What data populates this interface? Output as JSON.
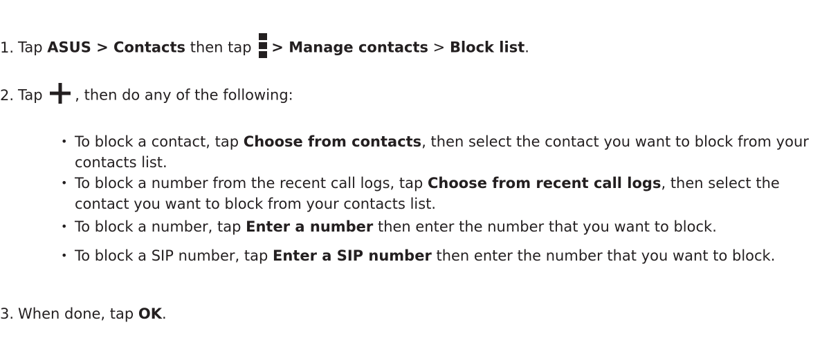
{
  "steps": [
    {
      "number": "1.",
      "t1": "Tap ",
      "b1": "ASUS > Contacts",
      "t2": " then tap ",
      "icon": "overflow-menu-icon",
      "b2": "> Manage contacts",
      "t3": " > ",
      "b3": "Block list",
      "t4": "."
    },
    {
      "number": "2.",
      "t1": "Tap ",
      "icon": "plus-icon",
      "t2": ", then do any of the following:"
    },
    {
      "number": "3.",
      "t1": "When done, tap ",
      "b1": "OK",
      "t2": "."
    }
  ],
  "bullets": [
    {
      "t1": "To block a contact, tap ",
      "b1": "Choose from contacts",
      "t2": ", then select the contact you want to block from your contacts list."
    },
    {
      "t1": "To block a number from the recent call logs, tap ",
      "b1": "Choose from recent call logs",
      "t2": ", then select the contact you want to block from your contacts list."
    },
    {
      "t1": "To block a number, tap ",
      "b1": "Enter a number",
      "t2": " then enter the number that you want to block."
    },
    {
      "t1": "To block a SIP number, tap ",
      "b1": "Enter a SIP number",
      "t2": " then enter the number that you want to block."
    }
  ],
  "bullet_char": "•"
}
